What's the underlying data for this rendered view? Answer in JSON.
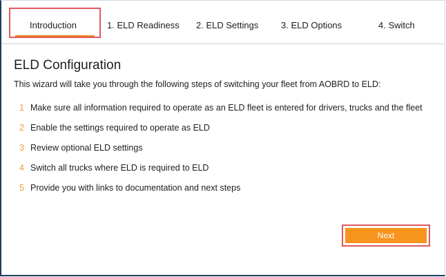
{
  "tabs": [
    {
      "label": "Introduction"
    },
    {
      "label": "1. ELD Readiness"
    },
    {
      "label": "2. ELD Settings"
    },
    {
      "label": "3. ELD Options"
    },
    {
      "label": "4. Switch"
    }
  ],
  "main": {
    "title": "ELD Configuration",
    "intro": "This wizard will take you through the following steps of switching your fleet from AOBRD to ELD:",
    "steps": [
      {
        "num": "1",
        "text": "Make sure all information required to operate as an ELD fleet is entered for drivers, trucks and the fleet"
      },
      {
        "num": "2",
        "text": "Enable the settings required to operate as ELD"
      },
      {
        "num": "3",
        "text": "Review optional ELD settings"
      },
      {
        "num": "4",
        "text": "Switch all trucks where ELD is required to ELD"
      },
      {
        "num": "5",
        "text": "Provide you with links to documentation and next steps"
      }
    ],
    "next_label": "Next"
  },
  "colors": {
    "accent": "#f7941d",
    "highlight_border": "#e0585c",
    "step_number": "#f29a3a"
  }
}
